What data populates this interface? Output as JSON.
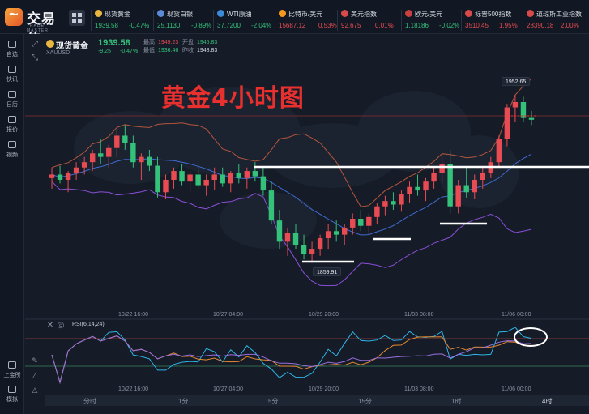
{
  "header": {
    "brand": "交易侠",
    "brand_sub": "TRADE MASTER",
    "quotes": [
      {
        "name": "现货黄金",
        "price": "1939.58",
        "change": "-0.47%",
        "icon_color": "#e9b741",
        "trend": "down"
      },
      {
        "name": "现货白银",
        "price": "25.1130",
        "change": "-0.89%",
        "icon_color": "#5b8bd6",
        "trend": "down"
      },
      {
        "name": "WTI原油",
        "price": "37.7200",
        "change": "-2.04%",
        "icon_color": "#3a8ad8",
        "trend": "down"
      },
      {
        "name": "比特币/美元",
        "price": "15687.12",
        "change": "0.53%",
        "icon_color": "#f39a1e",
        "trend": "up"
      },
      {
        "name": "美元指数",
        "price": "92.675",
        "change": "0.01%",
        "icon_color": "#d84a4a",
        "trend": "up"
      },
      {
        "name": "欧元/美元",
        "price": "1.18186",
        "change": "-0.02%",
        "icon_color": "#c94040",
        "trend": "down"
      },
      {
        "name": "标普500指数",
        "price": "3510.45",
        "change": "1.95%",
        "icon_color": "#d84a4a",
        "trend": "up"
      },
      {
        "name": "道琼斯工业指数",
        "price": "28390.18",
        "change": "2.00%",
        "icon_color": "#d84a4a",
        "trend": "up"
      }
    ]
  },
  "sidebar": {
    "items": [
      {
        "label": "自选",
        "icon": "star-icon"
      },
      {
        "label": "快讯",
        "icon": "news-icon"
      },
      {
        "label": "日历",
        "icon": "calendar-icon"
      },
      {
        "label": "报价",
        "icon": "quote-icon"
      },
      {
        "label": "视频",
        "icon": "video-icon"
      }
    ],
    "bottom_items": [
      {
        "label": "上金所",
        "icon": "exchange-icon"
      },
      {
        "label": "模拟",
        "icon": "simulate-icon"
      }
    ]
  },
  "symbol": {
    "name": "现货黄金",
    "code": "XAUUSD",
    "price": "1939.58",
    "change": "-9.25",
    "change_pct": "-0.47%",
    "high_label": "最高",
    "high": "1949.23",
    "open_label": "开盘",
    "open": "1945.83",
    "low_label": "最低",
    "low": "1936.46",
    "prev_label": "昨收",
    "prev": "1948.83"
  },
  "annotation": {
    "title": "黄金4小时图",
    "high_marker": "1952.65",
    "low_marker": "1859.91"
  },
  "rsi": {
    "title": "RSI(6,14,24)"
  },
  "x_axis": {
    "labels": [
      "10/22 16:00",
      "10/27 04:00",
      "10/29 20:00",
      "11/03 08:00",
      "11/06 00:00"
    ]
  },
  "timeframes": {
    "items": [
      "分时",
      "1分",
      "5分",
      "15分",
      "1时",
      "4时"
    ],
    "active": "4时"
  },
  "colors": {
    "bull": "#e84c52",
    "bear": "#34c17a",
    "band_upper": "#b5563d",
    "band_mid": "#3f6bd1",
    "band_lower": "#8a4fd8",
    "rsi1": "#2fb5e8",
    "rsi2": "#e58a30",
    "rsi3": "#9a6fe0",
    "annotation": "#e8302f"
  },
  "chart_data": {
    "type": "candlestick",
    "title": "黄金4小时图",
    "symbol": "XAUUSD",
    "x_ticks": [
      "10/22 16:00",
      "10/27 04:00",
      "10/29 20:00",
      "11/03 08:00",
      "11/06 00:00"
    ],
    "marked_high": 1952.65,
    "marked_low": 1859.91,
    "candles_ohlc": [
      [
        1906,
        1912,
        1900,
        1908
      ],
      [
        1908,
        1913,
        1903,
        1905
      ],
      [
        1905,
        1910,
        1898,
        1909
      ],
      [
        1909,
        1915,
        1905,
        1912
      ],
      [
        1912,
        1918,
        1908,
        1915
      ],
      [
        1915,
        1922,
        1910,
        1920
      ],
      [
        1920,
        1928,
        1914,
        1918
      ],
      [
        1918,
        1925,
        1912,
        1923
      ],
      [
        1923,
        1933,
        1918,
        1930
      ],
      [
        1930,
        1936,
        1922,
        1926
      ],
      [
        1926,
        1930,
        1912,
        1915
      ],
      [
        1915,
        1920,
        1905,
        1918
      ],
      [
        1918,
        1922,
        1910,
        1913
      ],
      [
        1913,
        1918,
        1895,
        1898
      ],
      [
        1898,
        1908,
        1894,
        1905
      ],
      [
        1905,
        1912,
        1900,
        1910
      ],
      [
        1910,
        1914,
        1902,
        1904
      ],
      [
        1904,
        1910,
        1898,
        1908
      ],
      [
        1908,
        1913,
        1900,
        1902
      ],
      [
        1902,
        1908,
        1896,
        1905
      ],
      [
        1905,
        1912,
        1899,
        1908
      ],
      [
        1908,
        1912,
        1901,
        1903
      ],
      [
        1903,
        1910,
        1898,
        1909
      ],
      [
        1909,
        1914,
        1903,
        1906
      ],
      [
        1906,
        1912,
        1900,
        1910
      ],
      [
        1910,
        1915,
        1904,
        1907
      ],
      [
        1907,
        1912,
        1896,
        1899
      ],
      [
        1899,
        1904,
        1880,
        1882
      ],
      [
        1882,
        1888,
        1866,
        1870
      ],
      [
        1870,
        1878,
        1862,
        1875
      ],
      [
        1875,
        1880,
        1866,
        1868
      ],
      [
        1868,
        1874,
        1860,
        1863
      ],
      [
        1863,
        1870,
        1858,
        1866
      ],
      [
        1866,
        1874,
        1862,
        1872
      ],
      [
        1872,
        1880,
        1866,
        1876
      ],
      [
        1876,
        1882,
        1870,
        1874
      ],
      [
        1874,
        1880,
        1868,
        1878
      ],
      [
        1878,
        1886,
        1874,
        1883
      ],
      [
        1883,
        1888,
        1876,
        1879
      ],
      [
        1879,
        1886,
        1874,
        1884
      ],
      [
        1884,
        1892,
        1880,
        1890
      ],
      [
        1890,
        1896,
        1885,
        1893
      ],
      [
        1893,
        1898,
        1888,
        1891
      ],
      [
        1891,
        1899,
        1887,
        1897
      ],
      [
        1897,
        1904,
        1892,
        1901
      ],
      [
        1901,
        1908,
        1896,
        1899
      ],
      [
        1899,
        1906,
        1893,
        1904
      ],
      [
        1904,
        1912,
        1900,
        1909
      ],
      [
        1909,
        1918,
        1903,
        1914
      ],
      [
        1914,
        1922,
        1886,
        1890
      ],
      [
        1890,
        1905,
        1886,
        1902
      ],
      [
        1902,
        1912,
        1895,
        1898
      ],
      [
        1898,
        1908,
        1894,
        1905
      ],
      [
        1905,
        1912,
        1900,
        1909
      ],
      [
        1909,
        1918,
        1906,
        1915
      ],
      [
        1915,
        1930,
        1912,
        1928
      ],
      [
        1928,
        1948,
        1924,
        1946
      ],
      [
        1946,
        1953,
        1938,
        1949
      ],
      [
        1949,
        1952,
        1938,
        1940
      ],
      [
        1940,
        1944,
        1936,
        1939
      ]
    ]
  }
}
